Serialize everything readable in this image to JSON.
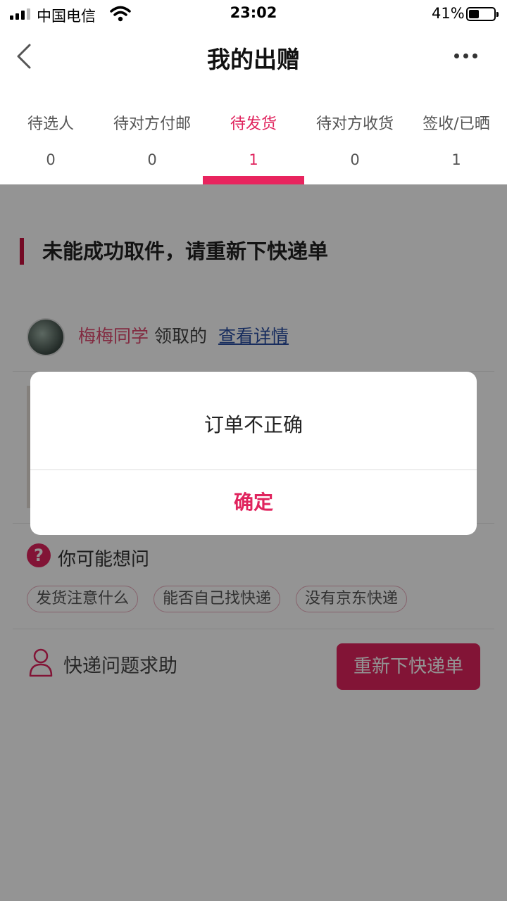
{
  "status_bar": {
    "carrier": "中国电信",
    "time": "23:02",
    "battery": "41%",
    "battery_level": 0.41
  },
  "nav": {
    "title": "我的出赠",
    "back_icon": "chevron-left-icon",
    "more_icon": "more-dots-icon"
  },
  "tabs": [
    {
      "label": "待选人",
      "count": "0"
    },
    {
      "label": "待对方付邮",
      "count": "0"
    },
    {
      "label": "待发货",
      "count": "1",
      "active": true
    },
    {
      "label": "待对方收货",
      "count": "0"
    },
    {
      "label": "签收/已晒",
      "count": "1"
    }
  ],
  "section": {
    "title": "未能成功取件，请重新下快递单"
  },
  "card": {
    "claim_user": "梅梅同学",
    "claim_text": "领取的",
    "detail_link": "查看详情",
    "faq_title": "你可能想问",
    "faq_chips": [
      "发货注意什么",
      "能否自己找快递",
      "没有京东快递"
    ],
    "help_label": "快递问题求助",
    "reorder_button": "重新下快递单"
  },
  "dialog": {
    "message": "订单不正确",
    "confirm": "确定"
  },
  "colors": {
    "accent": "#e0245e",
    "overlay": "rgba(0,0,0,0.42)"
  }
}
